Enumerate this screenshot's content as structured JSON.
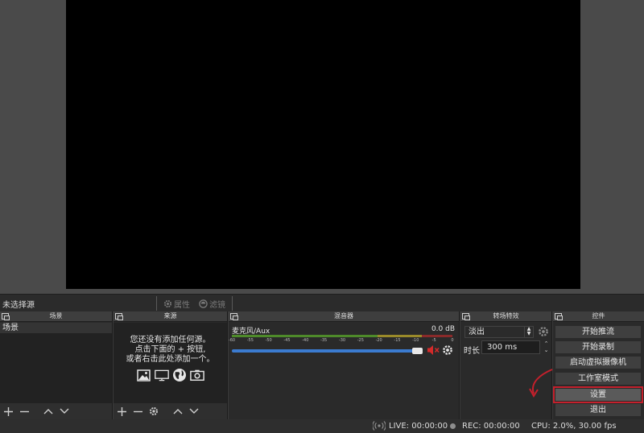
{
  "source_bar": {
    "no_source_selected": "未选择源",
    "properties_label": "属性",
    "filters_label": "滤镜"
  },
  "panels": {
    "scenes": {
      "title": "场景",
      "items": [
        "场景"
      ]
    },
    "sources": {
      "title": "来源",
      "empty_line1": "您还没有添加任何源。",
      "empty_line2": "点击下面的 + 按钮,",
      "empty_line3": "或者右击此处添加一个。"
    },
    "mixer": {
      "title": "混音器",
      "channel_name": "麦克风/Aux",
      "level": "0.0 dB",
      "ticks": [
        "-60",
        "-55",
        "-50",
        "-45",
        "-40",
        "-35",
        "-30",
        "-25",
        "-20",
        "-15",
        "-10",
        "-5",
        "0"
      ]
    },
    "transitions": {
      "title": "转场特效",
      "selected": "淡出",
      "duration_label": "时长",
      "duration_value": "300 ms"
    },
    "controls": {
      "title": "控件",
      "buttons": [
        "开始推流",
        "开始录制",
        "启动虚拟摄像机",
        "工作室模式",
        "设置",
        "退出"
      ]
    }
  },
  "status": {
    "live": "LIVE: 00:00:00",
    "rec": "REC: 00:00:00",
    "cpu": "CPU: 2.0%, 30.00 fps"
  },
  "colors": {
    "highlight_outline": "#c4202c",
    "annotation_arrow": "#c4202c",
    "volume_bar": "#3b7bd0"
  }
}
